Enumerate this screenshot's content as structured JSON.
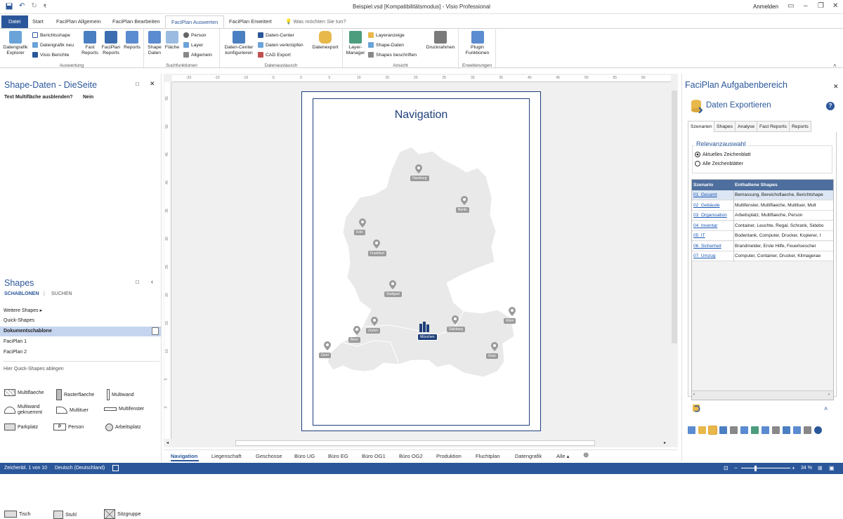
{
  "window": {
    "title": "Beispiel.vsd  [Kompatibilitätsmodus]  -  Visio Professional",
    "signin": "Anmelden",
    "qat_customize": "₹"
  },
  "tabs": {
    "file": "Datei",
    "items": [
      "Start",
      "FaciPlan Allgemein",
      "FaciPlan Bearbeiten",
      "FaciPlan Auswerten",
      "FaciPlan Erweitert"
    ],
    "tellme": "Was möchten Sie tun?"
  },
  "ribbon": {
    "auswertung": {
      "label": "Auswertung",
      "explorer": "Datengrafik Explorer",
      "berichtsshape": "Berichtsshape",
      "datengrafik_neu": "Datengrafik neu",
      "visio_berichte": "Visio Berichte",
      "fast_reports": "Fast Reports",
      "faciplan_reports": "FaciPlan Reports",
      "reports": "Reports"
    },
    "suchfunktionen": {
      "label": "Suchfunktionen",
      "shape_daten": "Shape Daten",
      "flaeche": "Fläche",
      "person": "Person",
      "layer": "Layer",
      "allgemein": "Allgemein"
    },
    "datenaustausch": {
      "label": "Datenaustausch",
      "dc_konfig": "Daten-Center konfigurieren",
      "datencenter": "Daten-Center",
      "verknuepfen": "Daten verknüpfen",
      "cad_export": "CAD Export",
      "datenexport": "Datenexport"
    },
    "ansicht": {
      "label": "Ansicht",
      "layer_manager": "Layer-Manager",
      "layeranzeige": "Layeranzeige",
      "shape_daten": "Shape-Daten",
      "shapes_beschriften": "Shapes beschriften",
      "druckrahmen": "Druckrahmen"
    },
    "erweiterungen": {
      "label": "Erweiterungen",
      "plugin": "Plugin Funktionen"
    }
  },
  "shape_data": {
    "title": "Shape-Daten - DieSeite",
    "rows": [
      {
        "key": "Text Multifläche ausblenden?",
        "value": "Nein"
      }
    ]
  },
  "shapes": {
    "title": "Shapes",
    "tab_stencils": "SCHABLONEN",
    "tab_search": "SUCHEN",
    "more": "Weitere Shapes",
    "stencils": [
      "Quick-Shapes",
      "Dokumentschablone",
      "FaciPlan 1",
      "FaciPlan 2"
    ],
    "drop_hint": "Hier Quick-Shapes ablegen",
    "quick": [
      "Multiflaeche",
      "Rasterflaeche",
      "Multiwand",
      "Multiwand gekruemmt",
      "Multituer",
      "Multifenster",
      "Parkplatz",
      "Person",
      "Arbeitsplatz",
      "Tisch",
      "Stuhl",
      "Sitzgruppe"
    ],
    "quick_person_tag": "P"
  },
  "ruler": {
    "h_ticks": [
      "-20",
      "-15",
      "-10",
      "-5",
      "0",
      "5",
      "10",
      "15",
      "20",
      "25",
      "30",
      "35",
      "40",
      "45",
      "50",
      "55",
      "60"
    ],
    "v_ticks": [
      "55",
      "50",
      "45",
      "40",
      "35",
      "30",
      "25",
      "20",
      "15",
      "10",
      "5",
      "0"
    ]
  },
  "drawing": {
    "title": "Navigation",
    "cities": [
      "Hamburg",
      "Berlin",
      "Köln",
      "Frankfurt",
      "Stuttgart",
      "München",
      "Salzburg",
      "Wien",
      "Zürich",
      "Bern",
      "Graz",
      "Genf"
    ],
    "highlight_city": "München",
    "map_color": "#e9e9e9",
    "accent": "#1e3f7a"
  },
  "sheets": {
    "items": [
      "Navigation",
      "Liegenschaft",
      "Geschosse",
      "Büro UG",
      "Büro EG",
      "Büro OG1",
      "Büro OG2",
      "Produktion",
      "Fluchtplan",
      "Datengrafik"
    ],
    "all": "Alle ▴",
    "add": "⊕"
  },
  "task_pane": {
    "title": "FaciPlan Aufgabenbereich",
    "heading": "Daten Exportieren",
    "help": "?",
    "tabs": [
      "Szenarien",
      "Shapes",
      "Analyse",
      "Fast Reports",
      "Reports"
    ],
    "relevance": {
      "label": "Relevanzauswahl",
      "options": [
        "Aktuelles Zeichenblatt",
        "Alle Zeichenblätter"
      ],
      "selected": 0
    },
    "table": {
      "headers": [
        "Szenario",
        "Enthaltene Shapes"
      ],
      "rows": [
        [
          "01_Gesamt",
          "Bemassung, Bereichsflaeche, Berichtshape"
        ],
        [
          "02_Gebäude",
          "Multifenster, Multiflaeche, Multituer, Mult"
        ],
        [
          "03_Organisation",
          "Arbeitsplatz, Multiflaeche, Person"
        ],
        [
          "04_Inventar",
          "Container, Leuchte, Regal, Schrank, Sidebo"
        ],
        [
          "05_IT",
          "Bodentank, Computer, Drucker, Kopierer, I"
        ],
        [
          "06_Sicherheit",
          "Brandmelder, Erste Hilfe, Feuerloescher"
        ],
        [
          "07_Umzug",
          "Computer, Container, Drucker, Klimagerae"
        ]
      ]
    }
  },
  "status": {
    "page": "Zeichenbl. 1 von 10",
    "language": "Deutsch (Deutschland)",
    "zoom": "34 %",
    "zoom_level": 0.34
  },
  "colors": {
    "brand": "#2b579a",
    "link": "#1a57b3"
  }
}
